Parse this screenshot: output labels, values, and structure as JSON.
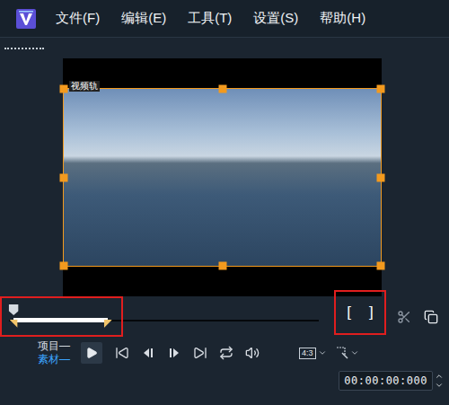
{
  "menu": [
    {
      "label": "文件(F)"
    },
    {
      "label": "编辑(E)"
    },
    {
      "label": "工具(T)"
    },
    {
      "label": "设置(S)"
    },
    {
      "label": "帮助(H)"
    }
  ],
  "preview": {
    "track_label": "视频轨",
    "selected": true
  },
  "scrubber": {
    "playhead": 0.015,
    "trim_start": 0.015,
    "trim_end": 0.32
  },
  "mark_buttons": {
    "in": "[",
    "out": "]"
  },
  "modes": [
    {
      "label": "项目—",
      "selected": false
    },
    {
      "label": "素材—",
      "selected": true
    }
  ],
  "aspect": {
    "label": "4:3"
  },
  "timecode": "00:00:00:000"
}
